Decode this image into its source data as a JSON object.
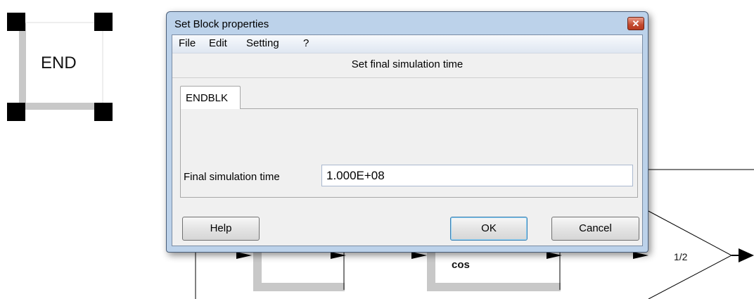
{
  "window": {
    "title": "Set Block properties",
    "close_glyph": "✕"
  },
  "menu": {
    "items": [
      "File",
      "Edit",
      "Setting",
      "?"
    ]
  },
  "header": {
    "text": "Set final simulation time"
  },
  "tabs": [
    {
      "label": "ENDBLK"
    }
  ],
  "form": {
    "label": "Final simulation time",
    "value": "1.000E+08"
  },
  "buttons": {
    "help": "Help",
    "ok": "OK",
    "cancel": "Cancel"
  },
  "diagram": {
    "end_block_label": "END",
    "cos_block_label": "cos",
    "gain_label": "1/2"
  },
  "colors": {
    "dialog_frame": "#bcd2ea",
    "client_bg": "#f0f0f0",
    "close_button": "#c24a2f",
    "handle": "#000000",
    "block_border": "#c8c8c8"
  }
}
